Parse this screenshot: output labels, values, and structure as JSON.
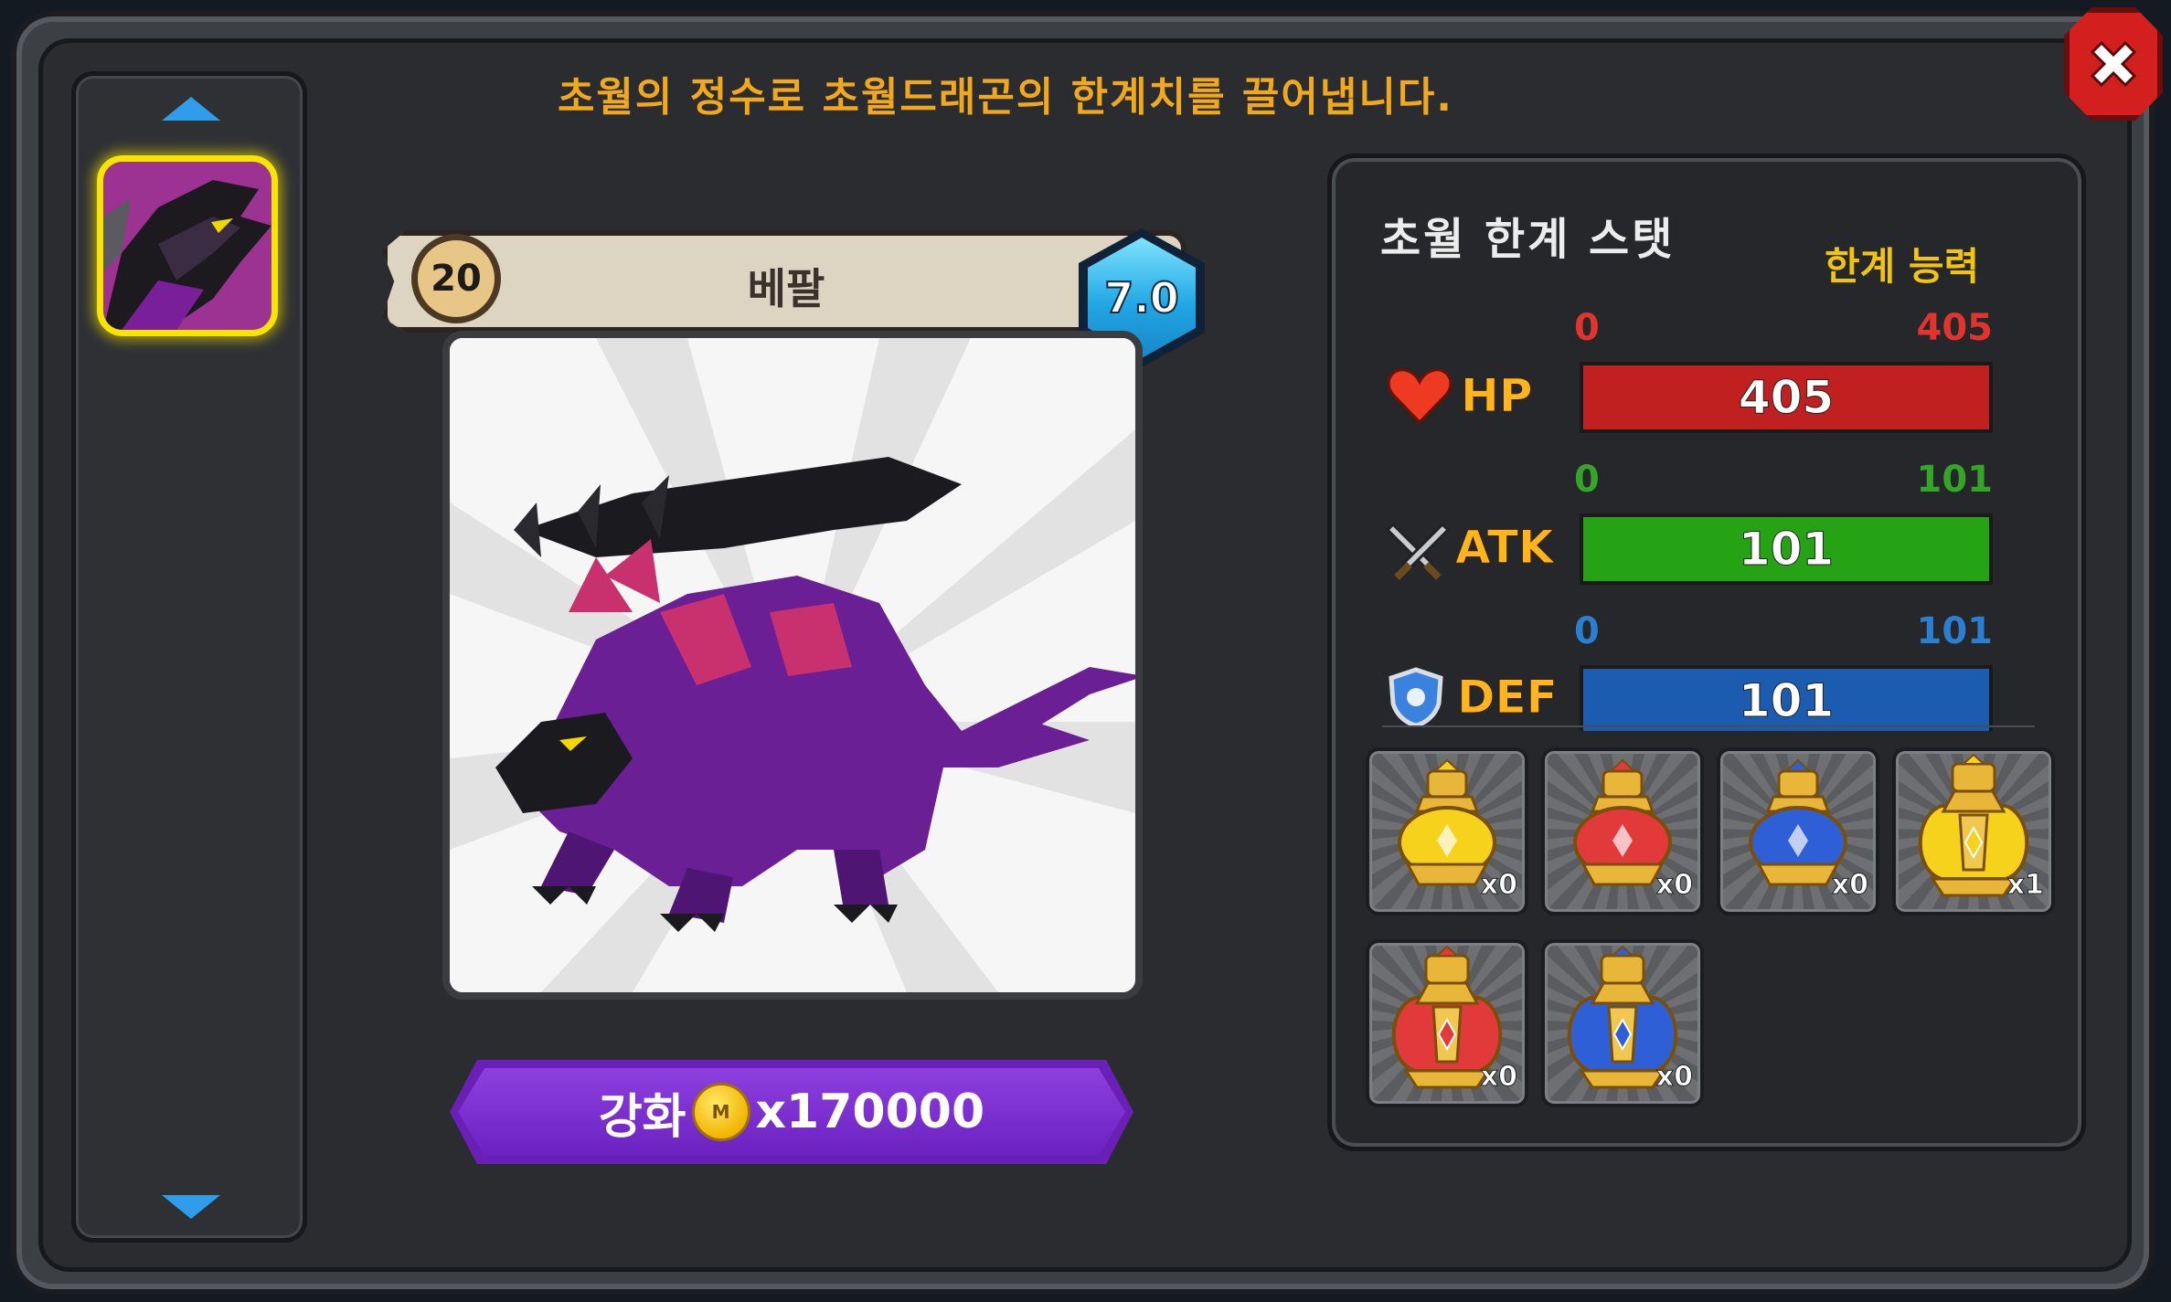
{
  "header": {
    "instruction": "초월의 정수로 초월드래곤의 한계치를 끌어냅니다."
  },
  "dragon": {
    "name": "베팔",
    "level": "20",
    "grade": "7.0"
  },
  "enhance": {
    "label": "강화",
    "currency_symbol": "M",
    "cost": "x170000"
  },
  "stats": {
    "title": "초월 한계 스탯",
    "limit_label": "한계 능력",
    "rows": [
      {
        "label": "HP",
        "min": "0",
        "max": "405",
        "value": "405",
        "fraction": 1.0,
        "color": "#c0201f",
        "range_color": "#e0342c"
      },
      {
        "label": "ATK",
        "min": "0",
        "max": "101",
        "value": "101",
        "fraction": 1.0,
        "color": "#26a215",
        "range_color": "#33a626"
      },
      {
        "label": "DEF",
        "min": "0",
        "max": "101",
        "value": "101",
        "fraction": 1.0,
        "color": "#1c5cb0",
        "range_color": "#2b7fd0"
      }
    ]
  },
  "items": [
    {
      "icon": "yellow-essence-icon",
      "count": "x0",
      "color": "#f6d21c"
    },
    {
      "icon": "red-essence-icon",
      "count": "x0",
      "color": "#e23a3a"
    },
    {
      "icon": "blue-essence-icon",
      "count": "x0",
      "color": "#2f5fd6"
    },
    {
      "icon": "large-yellow-essence-icon",
      "count": "x1",
      "color": "#f6d21c"
    },
    {
      "icon": "large-red-essence-icon",
      "count": "x0",
      "color": "#e23a3a"
    },
    {
      "icon": "large-blue-essence-icon",
      "count": "x0",
      "color": "#2f5fd6"
    }
  ]
}
